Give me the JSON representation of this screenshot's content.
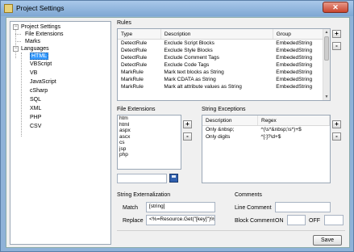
{
  "window": {
    "title": "Project Settings",
    "close_label": "✕"
  },
  "tree": {
    "root": "Project Settings",
    "children": [
      "File Extensions",
      "Marks",
      "Languages"
    ],
    "languages": [
      "HTML",
      "VBScript",
      "VB",
      "JavaScript",
      "cSharp",
      "SQL",
      "XML",
      "PHP",
      "CSV"
    ],
    "selected": "HTML"
  },
  "rules": {
    "label": "Rules",
    "columns": [
      "Type",
      "Description",
      "Group"
    ],
    "rows": [
      [
        "DetectRule",
        "Exclude Script Blocks",
        "EmbededString"
      ],
      [
        "DetectRule",
        "Exclude Style Blocks",
        "EmbededString"
      ],
      [
        "DetectRule",
        "Exclude Comment Tags",
        "EmbededString"
      ],
      [
        "DetectRule",
        "Exclude Code Tags",
        "EmbededString"
      ],
      [
        "MarkRule",
        "Mark text blocks as String",
        "EmbededString"
      ],
      [
        "MarkRule",
        "Mark CDATA as String",
        "EmbededString"
      ],
      [
        "MarkRule",
        "Mark alt attribute values as String",
        "EmbededString"
      ]
    ],
    "add": "+",
    "remove": "-"
  },
  "file_extensions": {
    "label": "File Extensions",
    "items": [
      "htm",
      "html",
      "aspx",
      "ascx",
      "cs",
      "jsp",
      "php"
    ],
    "input_value": "",
    "add": "+",
    "remove": "-"
  },
  "string_exceptions": {
    "label": "String Exceptions",
    "columns": [
      "Description",
      "Regex"
    ],
    "rows": [
      [
        "Only &nbsp;",
        "^(\\s*&nbsp;\\s*)+$"
      ],
      [
        "Only digits",
        "^[:]?\\d+$"
      ]
    ],
    "add": "+",
    "remove": "-"
  },
  "externalization": {
    "label": "String Externalization",
    "match_label": "Match",
    "match_value": "[string]",
    "replace_label": "Replace",
    "replace_value": "<%=Resource.Get(\"[key]\")%>"
  },
  "comments": {
    "label": "Comments",
    "line_label": "Line Comment",
    "line_value": "",
    "block_label": "Block Comment",
    "on_label": "ON",
    "on_value": "",
    "off_label": "OFF",
    "off_value": ""
  },
  "save_label": "Save"
}
